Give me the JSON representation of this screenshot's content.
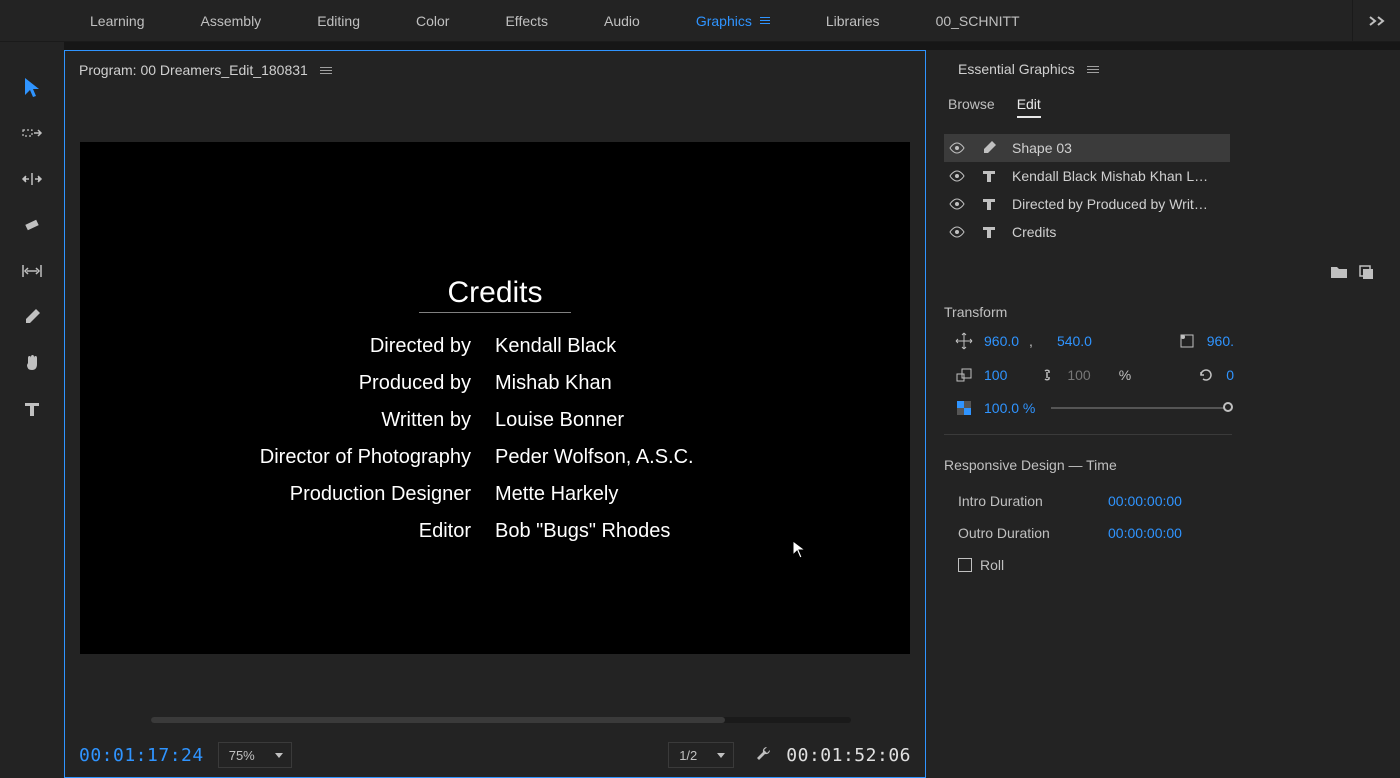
{
  "workspace_tabs": [
    "Learning",
    "Assembly",
    "Editing",
    "Color",
    "Effects",
    "Audio",
    "Graphics",
    "Libraries",
    "00_SCHNITT"
  ],
  "active_workspace": "Graphics",
  "program": {
    "prefix": "Program:",
    "name": "00 Dreamers_Edit_180831"
  },
  "credits": {
    "title": "Credits",
    "rows": [
      {
        "role": "Directed by",
        "name": "Kendall Black"
      },
      {
        "role": "Produced by",
        "name": "Mishab Khan"
      },
      {
        "role": "Written by",
        "name": "Louise Bonner"
      },
      {
        "role": "Director of Photography",
        "name": "Peder Wolfson, A.S.C."
      },
      {
        "role": "Production Designer",
        "name": "Mette Harkely"
      },
      {
        "role": "Editor",
        "name": "Bob \"Bugs\" Rhodes"
      }
    ]
  },
  "timecode_in": "00:01:17:24",
  "zoom": "75%",
  "resolution": "1/2",
  "timecode_out": "00:01:52:06",
  "essential_graphics": {
    "title": "Essential Graphics",
    "tabs": [
      "Browse",
      "Edit"
    ],
    "active_tab": "Edit",
    "layers": [
      {
        "type": "shape",
        "name": "Shape 03"
      },
      {
        "type": "text",
        "name": "Kendall Black Mishab Khan L…"
      },
      {
        "type": "text",
        "name": "Directed by Produced by Writ…"
      },
      {
        "type": "text",
        "name": "Credits"
      }
    ],
    "transform": {
      "title": "Transform",
      "position_x": "960.0",
      "position_y": "540.0",
      "anchor": "960.",
      "scale_w": "100",
      "scale_h": "100",
      "scale_unit": "%",
      "rotation": "0",
      "opacity": "100.0 %"
    },
    "responsive": {
      "title": "Responsive Design — Time",
      "intro_label": "Intro Duration",
      "intro_val": "00:00:00:00",
      "outro_label": "Outro Duration",
      "outro_val": "00:00:00:00",
      "roll_label": "Roll"
    }
  },
  "comma": ","
}
